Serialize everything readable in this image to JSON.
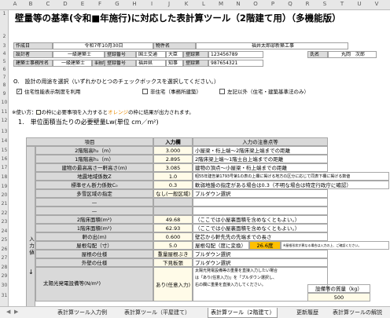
{
  "columns": [
    "A",
    "B",
    "C",
    "D",
    "E",
    "F",
    "G",
    "H",
    "I",
    "J",
    "K",
    "L",
    "M",
    "N",
    "O",
    "P",
    "Q",
    "R",
    "S",
    "T",
    "U",
    "V"
  ],
  "rows": [
    "1",
    "2",
    "3",
    "4",
    "5",
    "6",
    "7",
    "8",
    "9",
    "10",
    "11",
    "12",
    "13",
    "14",
    "15",
    "16",
    "17",
    "18",
    "19",
    "20",
    "21",
    "22",
    "23",
    "24",
    "25",
    "26",
    "27",
    "28",
    "29",
    "30",
    "31"
  ],
  "title": "壁量等の基準(令和■年施行)に対応した表計算ツール（2階建て用）（多機能版）",
  "info": {
    "l1": "作成日",
    "v1": "令和7年10月30日",
    "l2": "物件名",
    "v2": "福井太郎邸新築工事",
    "l3": "設計者",
    "v3": "一級建築士",
    "l3b": "登録番号",
    "v3b": "国土交通",
    "v3c": "大臣",
    "l3c": "登録第",
    "v3d": "123456789",
    "l3d": "氏名",
    "v3e": "丸岡　次郎",
    "l4": "建築士事務所名",
    "v4": "一級建築士",
    "l4a": "事務所",
    "l4b": "登録番号",
    "v4b": "福井県",
    "v4c": "知事",
    "l4c": "登録第",
    "v4d": "987654321"
  },
  "usage": {
    "heading": "O.　設計の用途を選択（いずれかひとつのチェックボックスを選択してください。）",
    "opt1": "住宅性能表示制度を利用",
    "opt2": "非住宅（事務所建築）",
    "opt3": "左記以外（住宅・建築基準法のみ）",
    "opt1_checked": "✓"
  },
  "howto": {
    "pre": "※使い方：",
    "mid": "の枠に必要事項を入力すると",
    "orange": "オレンジ",
    "post": "の枠に結果が出力されます。"
  },
  "section_title": "1.　単位面積当たりの必要壁量Lw(単位 cm／m²)",
  "headers": {
    "item": "項目",
    "input": "入力欄",
    "note": "入力の注意点等"
  },
  "side_label": "入力値",
  "side_mark": "↓",
  "table_rows": [
    {
      "item": "2階階高h₂（m）",
      "val": "3.000",
      "note": "小屋梁・桁上端〜2階床梁上端までの距離"
    },
    {
      "item": "1階階高h₁（m）",
      "val": "2.895",
      "note": "2階床梁上端〜1階土台上端までの距離"
    },
    {
      "item": "建物の最高高さ一軒高さ(m)",
      "val": "3.085",
      "note": "建物の頂点〜小屋梁・桁上端までの距離"
    },
    {
      "item": "地震地域係数Z",
      "val": "1.0",
      "note": "昭55年建告第1793号第1の表の上欄に掲げる地方の区分に応じて同表下欄に掲げる数値"
    },
    {
      "item": "標準せん断力係数C₀",
      "val": "0.3",
      "note": "軟弱地盤の指定がある場合は0.3（不明な場合は特定行政庁に確認）"
    },
    {
      "item": "多雪区域の指定",
      "val": "なし(一般区域)",
      "note": "プルダウン選択"
    },
    {
      "item": "—",
      "val": "",
      "note": ""
    },
    {
      "item": "—",
      "val": "",
      "note": ""
    },
    {
      "item": "2階床面積(m²)",
      "val": "49.68",
      "note": "（ここでは小屋裏面積を含めなくともよい。）"
    },
    {
      "item": "1階床面積(m²)",
      "val": "62.93",
      "note": "（ここでは小屋裏面積を含めなくともよい。）"
    },
    {
      "item": "軒の出(m)",
      "val": "0.600",
      "note": "壁芯から軒先先の先端までの長さ"
    },
    {
      "item": "屋根勾配（寸）",
      "val": "5.0",
      "note": "屋根勾配（度に変換）",
      "extra": "26.6度",
      "extra_note": "※屋根形状が異なる場合は入力の上、ご確認ください。"
    },
    {
      "item": "屋根の仕様",
      "val": "重量屋根ぶき",
      "note": "プルダウン選択"
    },
    {
      "item": "外壁の仕様",
      "val": "下見板張",
      "note": "プルダウン選択"
    },
    {
      "item": "太陽光発電設備等(N/m²)",
      "val": "あり(任意入力)",
      "note": "太陽光発電設備等の重量を直接入力したい場合",
      "note2": "は「あり(任意入力)」を「プルダウン選択し、",
      "note3": "右の欄に重量を直接入力してください。",
      "weight_label": "設備等の質量（kg）",
      "weight_val": "500"
    }
  ],
  "tabs": [
    "表計算ツール入力例",
    "表計算ツール（平屋建て）",
    "表計算ツール（2階建て）",
    "更新履歴",
    "表計算ツールの解説"
  ],
  "colors": {
    "orange": "#ffc000",
    "gray_label": "#d9d9d9",
    "input_bg": "#fffbe8"
  }
}
